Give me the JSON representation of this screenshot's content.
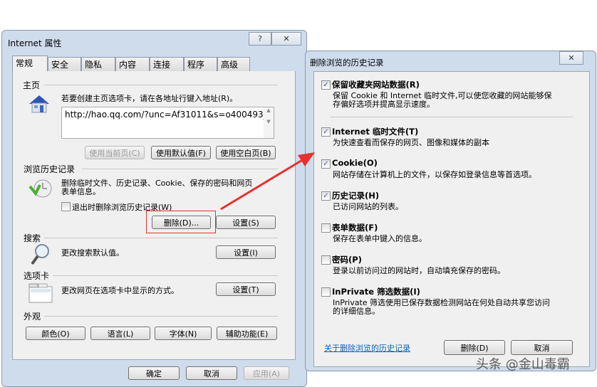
{
  "internet_options": {
    "title": "Internet 属性",
    "help": "?",
    "close": "✕",
    "tabs": [
      "常规",
      "安全",
      "隐私",
      "内容",
      "连接",
      "程序",
      "高级"
    ],
    "homepage": {
      "heading": "主页",
      "desc": "若要创建主页选项卡，请在各地址行键入地址(R)。",
      "url": "http://hao.qq.com/?unc=Af31011&s=o400493_",
      "use_current": "使用当前页(C)",
      "use_default": "使用默认值(F)",
      "use_blank": "使用空白页(B)"
    },
    "history": {
      "heading": "浏览历史记录",
      "desc1": "删除临时文件、历史记录、Cookie、保存的密码和网页",
      "desc2": "表单信息。",
      "exit_checkbox": "退出时删除浏览历史记录(W)",
      "delete": "删除(D)...",
      "settings": "设置(S)"
    },
    "search": {
      "heading": "搜索",
      "desc": "更改搜索默认值。",
      "settings": "设置(I)"
    },
    "tabs_section": {
      "heading": "选项卡",
      "desc": "更改网页在选项卡中显示的方式。",
      "settings": "设置(T)"
    },
    "appearance": {
      "heading": "外观",
      "colors": "颜色(O)",
      "languages": "语言(L)",
      "fonts": "字体(N)",
      "accessibility": "辅助功能(E)"
    },
    "ok": "确定",
    "cancel": "取消",
    "apply": "应用(A)"
  },
  "delete_history": {
    "title": "删除浏览的历史记录",
    "close": "✕",
    "items": [
      {
        "label": "保留收藏夹网站数据(R)",
        "desc": [
          "保留 Cookie 和 Internet 临时文件,可以使您收藏的网站能够保",
          "存偏好选项并提高显示速度。"
        ],
        "checked": true
      },
      {
        "label": "Internet 临时文件(T)",
        "desc": [
          "为快速查看而保存的网页、图像和媒体的副本"
        ],
        "checked": true
      },
      {
        "label": "Cookie(O)",
        "desc": [
          "网站存储在计算机上的文件，以保存如登录信息等首选项。"
        ],
        "checked": true
      },
      {
        "label": "历史记录(H)",
        "desc": [
          "已访问网站的列表。"
        ],
        "checked": true
      },
      {
        "label": "表单数据(F)",
        "desc": [
          "保存在表单中键入的信息。"
        ],
        "checked": false
      },
      {
        "label": "密码(P)",
        "desc": [
          "登录以前访问过的网站时，自动填充保存的密码。"
        ],
        "checked": false
      },
      {
        "label": "InPrivate 筛选数据(I)",
        "desc": [
          "InPrivate 筛选使用已保存数据检测网站在何处自动共享您访问",
          "的详细信息。"
        ],
        "checked": false
      }
    ],
    "about_link": "关于删除浏览的历史记录",
    "delete": "删除(D)",
    "cancel": "取消"
  },
  "watermark": "头条 @金山毒霸",
  "colors": {
    "annotation": "#e8302c",
    "link": "#0b64c0"
  }
}
